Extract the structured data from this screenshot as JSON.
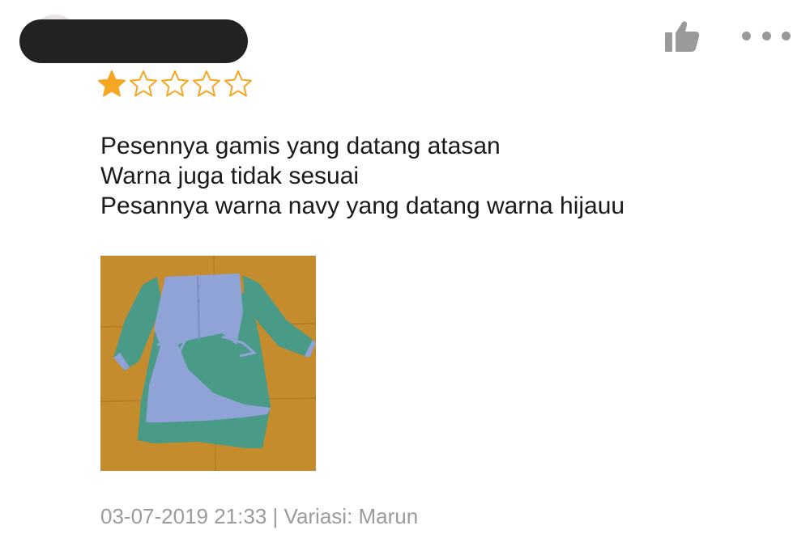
{
  "review": {
    "rating": 1,
    "rating_max": 5,
    "lines": [
      "Pesennya gamis yang datang atasan",
      "Warna juga tidak sesuai",
      "Pesannya warna navy yang datang warna hijauu"
    ],
    "timestamp": "03-07-2019 21:33",
    "separator": "|",
    "variation": "Variasi: Marun"
  },
  "icons": {
    "like": "thumbs-up-icon",
    "more": "more-dots-icon",
    "star_filled": "star-filled-icon",
    "star_empty": "star-outline-icon"
  },
  "colors": {
    "star_filled": "#f5a623",
    "star_outline": "#f5a623",
    "text": "#1a1a1a",
    "meta": "#9b9b9b",
    "icon": "#9a9a9a",
    "redaction": "#222222"
  }
}
